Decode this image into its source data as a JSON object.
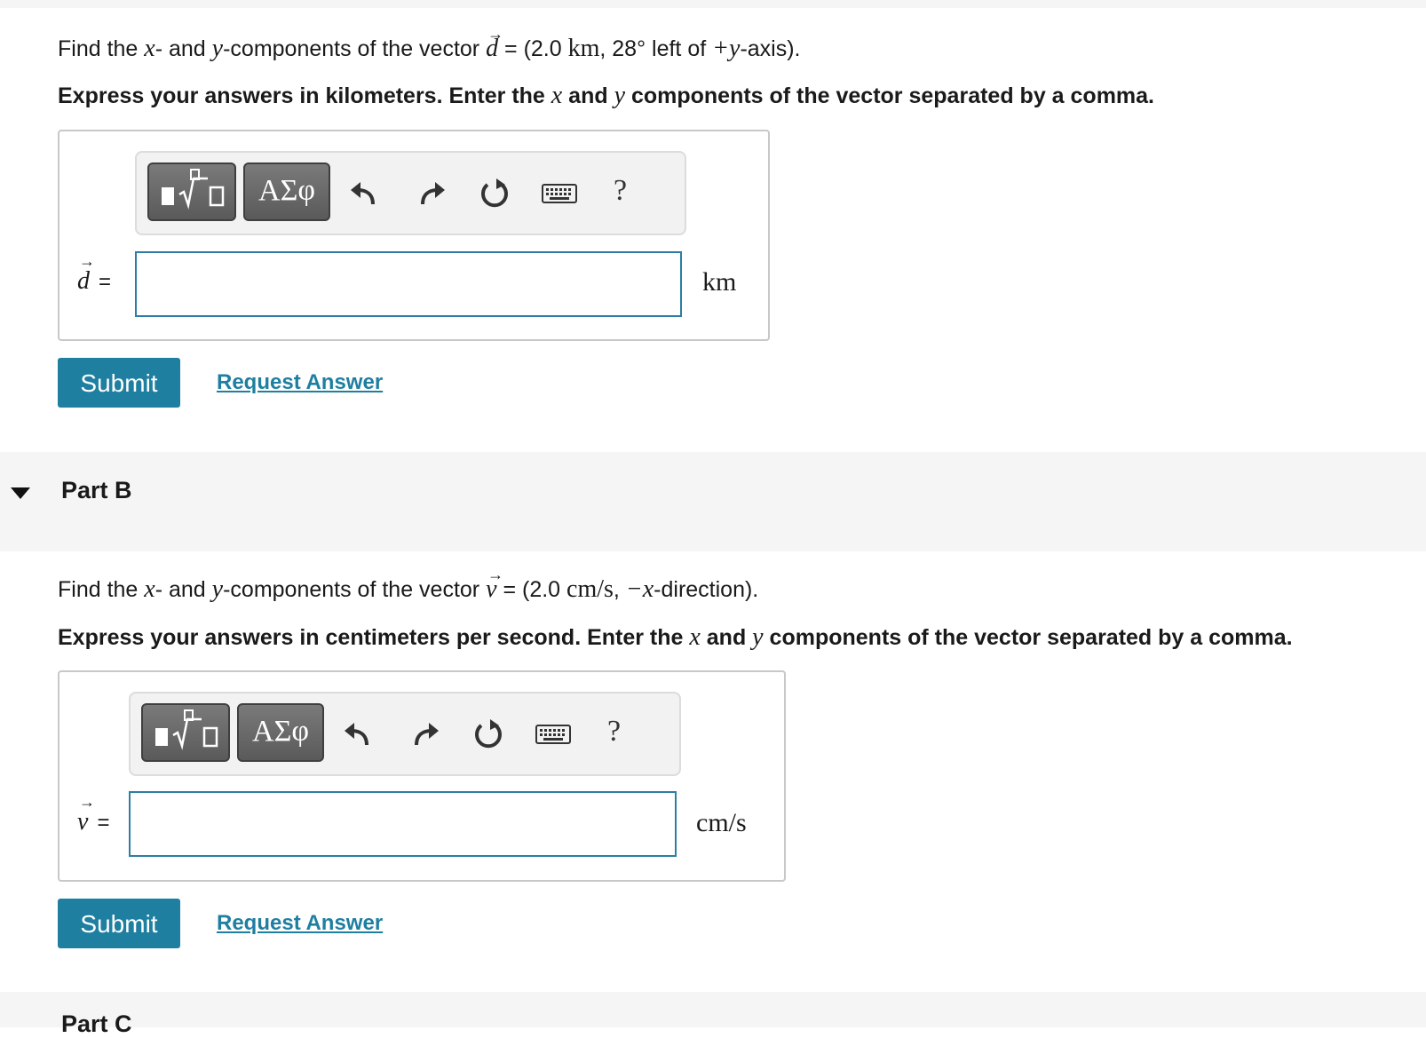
{
  "partA": {
    "prompt": {
      "find": "Find the ",
      "x": "x",
      "mid1": "- and ",
      "y": "y",
      "mid2": "-components of the vector ",
      "vec": "d",
      "eq": " = (2.0 ",
      "unit": "km",
      "angle": ", 28° left of ",
      "plusy": "+y",
      "end": "-axis)."
    },
    "instruction": {
      "a": "Express your answers in kilometers. Enter the ",
      "x": "x",
      "and": " and ",
      "y": "y",
      "b": " components of the vector separated by a comma."
    },
    "toolbar": {
      "symbols_label": "ΑΣφ",
      "help_label": "?"
    },
    "lhs_var": "d",
    "lhs_eq": "=",
    "input_value": "",
    "unit_label": "km",
    "submit_label": "Submit",
    "request_label": "Request Answer"
  },
  "partB": {
    "title": "Part B",
    "prompt": {
      "find": "Find the ",
      "x": "x",
      "mid1": "- and ",
      "y": "y",
      "mid2": "-components of the vector ",
      "vec": "v",
      "eq": " = (2.0 ",
      "unit": "cm/s",
      "sep": ", ",
      "negx": "−x",
      "end": "-direction)."
    },
    "instruction": {
      "a": "Express your answers in centimeters per second. Enter the ",
      "x": "x",
      "and": " and ",
      "y": "y",
      "b": " components of the vector separated by a comma."
    },
    "toolbar": {
      "symbols_label": "ΑΣφ",
      "help_label": "?"
    },
    "lhs_var": "v",
    "lhs_eq": "=",
    "input_value": "",
    "unit_label": "cm/s",
    "submit_label": "Submit",
    "request_label": "Request Answer"
  },
  "partC": {
    "title": "Part C"
  },
  "colors": {
    "accent": "#1f7fa0",
    "input_border": "#2d7ea3",
    "band": "#f5f5f5"
  },
  "icons": [
    "templates-icon",
    "greek-symbols-icon",
    "undo-icon",
    "redo-icon",
    "reset-icon",
    "keyboard-icon",
    "help-icon",
    "collapse-caret-icon"
  ]
}
